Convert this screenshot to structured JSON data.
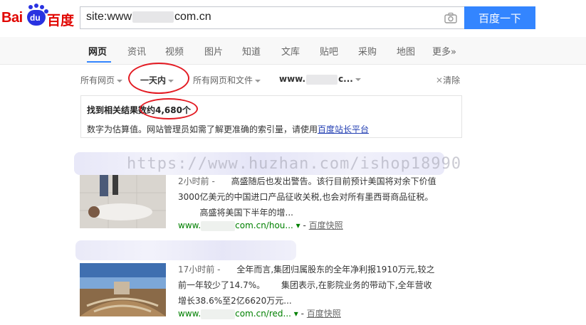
{
  "logo": {
    "left": "Bai",
    "du": "du",
    "right": "百度"
  },
  "search": {
    "query_prefix": "site:www",
    "query_suffix": "com.cn",
    "button": "百度一下"
  },
  "tabs": [
    {
      "label": "网页",
      "active": true
    },
    {
      "label": "资讯"
    },
    {
      "label": "视频"
    },
    {
      "label": "图片"
    },
    {
      "label": "知道"
    },
    {
      "label": "文库"
    },
    {
      "label": "贴吧"
    },
    {
      "label": "采购"
    },
    {
      "label": "地图"
    },
    {
      "label": "更多»"
    }
  ],
  "filters": {
    "all_pages": "所有网页",
    "time": "一天内",
    "file_type": "所有网页和文件",
    "site_prefix": "www.",
    "site_suffix": "c...",
    "clear": "清除"
  },
  "summary": {
    "count": "找到相关结果数约4,680个",
    "note": "数字为估算值。网站管理员如需了解更准确的索引量，请使用",
    "link": "百度站长平台"
  },
  "watermark": "https://www.huzhan.com/ishop18990",
  "results": [
    {
      "time": "2小时前 -",
      "line1": "高盛随后也发出警告。该行目前预计美国将对余下价值",
      "line2": "3000亿美元的中国进口产品征收关税,也会对所有墨西哥商品征税。",
      "line3": "高盛将美国下半年的增...",
      "url_prefix": "www.",
      "url_suffix": "com.cn/hou...",
      "snapshot": "百度快照"
    },
    {
      "time": "17小时前 -",
      "line1": "全年而言,集团归属股东的全年净利报1910万元,较之",
      "line2": "前一年较少了14.7%。",
      "line2b": "集团表示,在影院业务的带动下,全年营收",
      "line3": "增长38.6%至2亿6620万元...",
      "url_prefix": "www.",
      "url_suffix": "com.cn/red...",
      "snapshot": "百度快照"
    }
  ],
  "colors": {
    "accent": "#3385ff",
    "brand_red": "#e10601",
    "brand_blue": "#2932e1",
    "url_green": "#008000",
    "annotation_red": "#e31b23"
  }
}
